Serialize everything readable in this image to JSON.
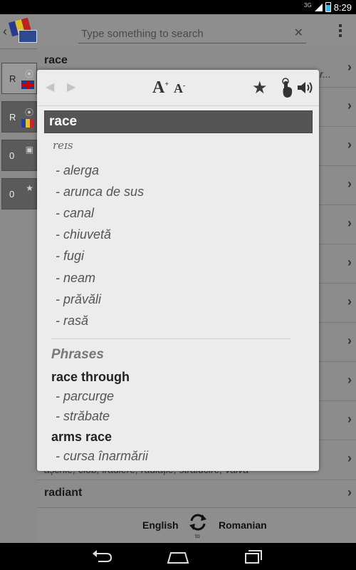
{
  "status_bar": {
    "network": "3G",
    "time": "8:29"
  },
  "search": {
    "placeholder": "Type something to search",
    "value": ""
  },
  "side_tabs": [
    {
      "label": "R",
      "flag": "uk",
      "icon": "voice-icon"
    },
    {
      "label": "R",
      "flag": "romania",
      "icon": "voice-icon"
    },
    {
      "label": "0",
      "icon": "history-icon"
    },
    {
      "label": "0",
      "icon": "star-icon"
    }
  ],
  "word_list": [
    {
      "word": "race",
      "preview": "ili; r..."
    },
    {
      "word": "",
      "preview": "așchie, clob, iradiere, radiație, strălucire, valvă"
    },
    {
      "word": "radiant",
      "preview": ""
    }
  ],
  "bottom_bar": {
    "from_language": "English",
    "to_label": "to",
    "to_language": "Romanian"
  },
  "popup": {
    "toolbar": {
      "back_icon": "back-arrow-icon",
      "forward_icon": "forward-arrow-icon",
      "font_increase": "A",
      "font_decrease": "A",
      "favorite_icon": "star-icon",
      "tap_icon": "touch-icon",
      "sound_icon": "speaker-icon"
    },
    "headword": "race",
    "pronunciation": "reɪs",
    "translations": [
      "- alerga",
      "- arunca de sus",
      "- canal",
      "- chiuvetă",
      "- fugi",
      "- neam",
      "- prăvăli",
      "- rasă"
    ],
    "phrases_title": "Phrases",
    "phrases": [
      {
        "phrase": "race through",
        "translations": [
          "- parcurge",
          "- străbate"
        ]
      },
      {
        "phrase": "arms race",
        "translations": [
          "- cursa înarmării"
        ]
      }
    ]
  },
  "colors": {
    "accent": "#33b5e5",
    "headword_bg": "#555555",
    "popup_bg": "#ececec"
  }
}
